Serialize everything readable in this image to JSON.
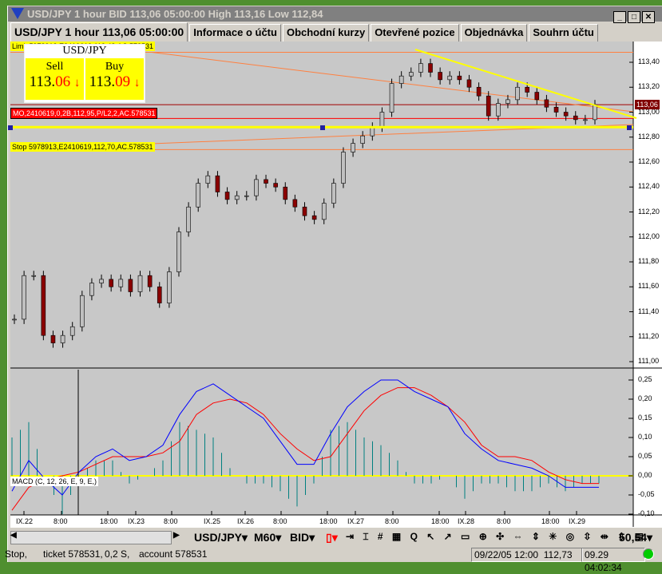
{
  "window": {
    "title": "USD/JPY 1 hour BID 113,06 05:00:00 High 113,16 Low 112,84",
    "min": "_",
    "max": "□",
    "close": "✕"
  },
  "tabs": [
    {
      "label": "USD/JPY 1 hour 113,06 05:00:00"
    },
    {
      "label": "Informace o účtu"
    },
    {
      "label": "Obchodní kurzy"
    },
    {
      "label": "Otevřené pozice"
    },
    {
      "label": "Objednávka"
    },
    {
      "label": "Souhrn účtu"
    }
  ],
  "quote_panel": {
    "symbol": "USD/JPY",
    "sell_label": "Sell",
    "buy_label": "Buy",
    "sell_base": "113.",
    "sell_pips": "06",
    "buy_base": "113.",
    "buy_pips": "09",
    "sell_arrow": "↓",
    "buy_arrow": "↓"
  },
  "order_labels": {
    "limit": "Limit 5978912,E2410619,113,48,AC.578531",
    "market": "MO,2410619,0,2B,112,95,P/L2,2,AC.578531",
    "stop": "Stop 5978913,E2410619,112,70,AC.578531"
  },
  "macd_label": "MACD (C, 12, 26, E, 9, E,)",
  "colors": {
    "down_candle": "#8b0000",
    "up_candle": "#c0c0c0",
    "macd": "#0000ff",
    "signal": "#ff0000",
    "histogram": "#008080",
    "trendline": "#ffff00",
    "order_line": "#ff8040"
  },
  "chart_data": [
    {
      "type": "candlestick",
      "ylim": [
        110.96,
        113.52
      ],
      "yticks": [
        "113,40",
        "113,20",
        "113,00",
        "112,80",
        "112,60",
        "112,40",
        "112,20",
        "112,00",
        "111,80",
        "111,60",
        "111,40",
        "111,20",
        "111,00"
      ],
      "current_price": "113,06",
      "close": [
        111.34,
        111.69,
        111.69,
        111.21,
        111.15,
        111.21,
        111.28,
        111.53,
        111.63,
        111.66,
        111.6,
        111.66,
        111.56,
        111.69,
        111.6,
        111.47,
        111.72,
        112.04,
        112.24,
        112.43,
        112.49,
        112.36,
        112.3,
        112.33,
        112.33,
        112.46,
        112.43,
        112.4,
        112.3,
        112.24,
        112.17,
        112.14,
        112.27,
        112.43,
        112.68,
        112.75,
        112.81,
        112.88,
        113.0,
        113.23,
        113.29,
        113.32,
        113.39,
        113.32,
        113.26,
        113.29,
        113.26,
        113.2,
        113.13,
        112.97,
        113.07,
        113.1,
        113.2,
        113.16,
        113.1,
        113.04,
        113.0,
        112.97,
        112.94,
        112.94,
        113.06
      ],
      "levels": {
        "limit": 113.48,
        "market_high": 113.06,
        "market_low": 112.95,
        "yellow": 112.88,
        "stop": 112.7
      }
    },
    {
      "type": "line",
      "name": "MACD (C, 12, 26, E, 9, E,)",
      "ylim": [
        -0.1,
        0.27
      ],
      "yticks": [
        "0,25",
        "0,20",
        "0,15",
        "0,10",
        "0,05",
        "0,00",
        "-0,05",
        "-0,10"
      ],
      "macd": [
        -0.04,
        0.04,
        -0.01,
        -0.05,
        0.01,
        0.05,
        0.07,
        0.04,
        0.05,
        0.08,
        0.16,
        0.22,
        0.24,
        0.21,
        0.18,
        0.15,
        0.09,
        0.03,
        0.03,
        0.11,
        0.18,
        0.22,
        0.25,
        0.25,
        0.22,
        0.2,
        0.18,
        0.11,
        0.07,
        0.04,
        0.03,
        0.02,
        0.0,
        -0.03,
        -0.03,
        -0.03
      ],
      "signal": [
        -0.09,
        -0.03,
        -0.01,
        0.0,
        0.01,
        0.03,
        0.05,
        0.05,
        0.05,
        0.06,
        0.09,
        0.16,
        0.19,
        0.2,
        0.19,
        0.16,
        0.11,
        0.07,
        0.04,
        0.05,
        0.11,
        0.17,
        0.21,
        0.23,
        0.23,
        0.21,
        0.18,
        0.14,
        0.08,
        0.05,
        0.05,
        0.04,
        0.01,
        -0.01,
        -0.02,
        -0.02
      ]
    }
  ],
  "time_axis": [
    "IX.22",
    "8:00",
    "18:00",
    "IX.23",
    "8:00",
    "IX.25",
    "IX.26",
    "8:00",
    "18:00",
    "IX.27",
    "8:00",
    "18:00",
    "IX.28",
    "8:00",
    "18:00",
    "IX.29"
  ],
  "toolbar": {
    "symbol": "USD/JPY",
    "period": "M60",
    "price_type": "BID",
    "zoom_value": "50,54"
  },
  "status": {
    "order_type": "Stop,",
    "ticket": "ticket 578531,",
    "amount": "0,2 S,",
    "account": "account 578531",
    "cursor_time": "09/22/05 12:00",
    "cursor_price": "112,73",
    "clock": "09.29 04:02:34"
  }
}
